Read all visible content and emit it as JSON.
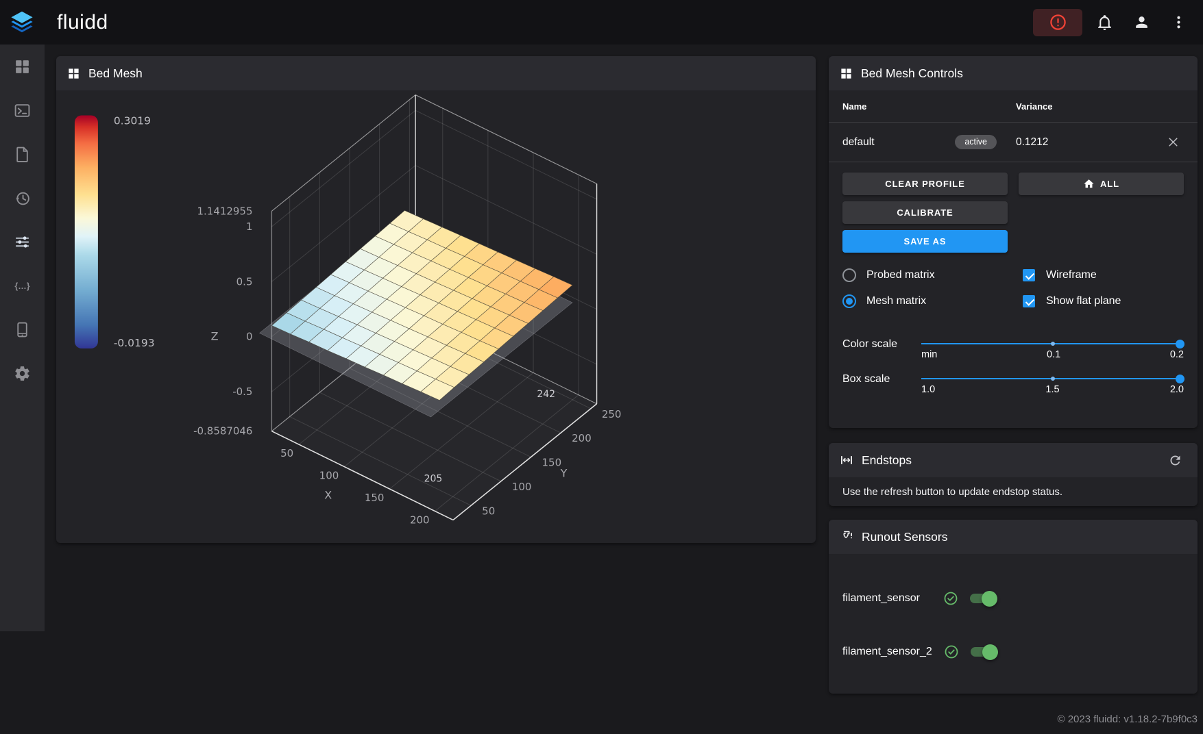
{
  "app": {
    "title": "fluidd",
    "footer": "© 2023 fluidd: v1.18.2-7b9f0c3"
  },
  "topbar": {
    "buttons": [
      "emergency-stop",
      "notifications",
      "account",
      "menu"
    ]
  },
  "sidebar": {
    "items": [
      {
        "name": "dashboard",
        "icon": "dashboard-icon",
        "active": false
      },
      {
        "name": "console",
        "icon": "console-icon",
        "active": false
      },
      {
        "name": "jobs",
        "icon": "jobs-icon",
        "active": false
      },
      {
        "name": "history",
        "icon": "history-icon",
        "active": false
      },
      {
        "name": "tune",
        "icon": "tune-icon",
        "active": true
      },
      {
        "name": "macros",
        "icon": "macros-icon",
        "active": false
      },
      {
        "name": "device",
        "icon": "device-icon",
        "active": false
      },
      {
        "name": "settings",
        "icon": "settings-icon",
        "active": false
      }
    ]
  },
  "bed_mesh": {
    "title": "Bed Mesh",
    "chart_data": {
      "type": "surface",
      "colorbar": {
        "max_label": "0.3019",
        "min_label": "-0.0193",
        "zmax": 0.3019,
        "zmin": -0.0193
      },
      "z_axis": {
        "label": "Z",
        "ticks": [
          "1.1412955",
          "1",
          "0.5",
          "0",
          "-0.5",
          "-0.8587046"
        ],
        "range": [
          -0.8587046,
          1.1412955
        ]
      },
      "x_axis": {
        "label": "X",
        "ticks": [
          "50",
          "100",
          "150",
          "200"
        ],
        "range": [
          20,
          220
        ],
        "mesh_min": 20,
        "mesh_max": 205,
        "end_label": "205"
      },
      "y_axis": {
        "label": "Y",
        "ticks": [
          "50",
          "100",
          "150",
          "200",
          "250"
        ],
        "range": [
          20,
          260
        ],
        "mesh_min": 20,
        "mesh_max": 242,
        "end_label": "242"
      },
      "flat_plane_z": 0.08,
      "mesh": [
        [
          0.101,
          0.107,
          0.117,
          0.122,
          0.132,
          0.138,
          0.148,
          0.154,
          0.163,
          0.169
        ],
        [
          0.109,
          0.115,
          0.124,
          0.131,
          0.139,
          0.146,
          0.154,
          0.161,
          0.17,
          0.177
        ],
        [
          0.116,
          0.123,
          0.131,
          0.14,
          0.147,
          0.155,
          0.161,
          0.17,
          0.176,
          0.185
        ],
        [
          0.124,
          0.13,
          0.139,
          0.146,
          0.155,
          0.162,
          0.17,
          0.177,
          0.186,
          0.192
        ],
        [
          0.131,
          0.139,
          0.146,
          0.155,
          0.162,
          0.171,
          0.177,
          0.186,
          0.192,
          0.201
        ],
        [
          0.139,
          0.146,
          0.155,
          0.161,
          0.17,
          0.178,
          0.185,
          0.193,
          0.2,
          0.208
        ],
        [
          0.147,
          0.154,
          0.162,
          0.17,
          0.177,
          0.185,
          0.193,
          0.201,
          0.208,
          0.216
        ],
        [
          0.154,
          0.162,
          0.169,
          0.178,
          0.185,
          0.193,
          0.2,
          0.209,
          0.215,
          0.224
        ],
        [
          0.162,
          0.169,
          0.178,
          0.184,
          0.193,
          0.2,
          0.209,
          0.216,
          0.224,
          0.231
        ],
        [
          0.17,
          0.177,
          0.185,
          0.193,
          0.201,
          0.208,
          0.216,
          0.223,
          0.232,
          0.239
        ]
      ]
    }
  },
  "controls": {
    "title": "Bed Mesh Controls",
    "table": {
      "headers": [
        "Name",
        "Variance"
      ],
      "rows": [
        {
          "name": "default",
          "badge": "active",
          "variance": "0.1212"
        }
      ]
    },
    "buttons": {
      "clear_profile": "CLEAR PROFILE",
      "all": "ALL",
      "calibrate": "CALIBRATE",
      "save_as": "SAVE AS"
    },
    "options": {
      "probed": {
        "label": "Probed matrix",
        "selected": false
      },
      "mesh": {
        "label": "Mesh matrix",
        "selected": true
      },
      "wireframe": {
        "label": "Wireframe",
        "checked": true
      },
      "flat_plane": {
        "label": "Show flat plane",
        "checked": true
      }
    },
    "color_scale": {
      "label": "Color scale",
      "ticks": [
        "min",
        "0.1",
        "0.2"
      ]
    },
    "box_scale": {
      "label": "Box scale",
      "ticks": [
        "1.0",
        "1.5",
        "2.0"
      ]
    }
  },
  "endstops": {
    "title": "Endstops",
    "message": "Use the refresh button to update endstop status."
  },
  "runout": {
    "title": "Runout Sensors",
    "sensors": [
      {
        "name": "filament_sensor",
        "enabled": true
      },
      {
        "name": "filament_sensor_2",
        "enabled": true
      }
    ]
  },
  "colors": {
    "accent": "#2196f3",
    "success": "#66bb6a",
    "estop": "#f44336"
  }
}
